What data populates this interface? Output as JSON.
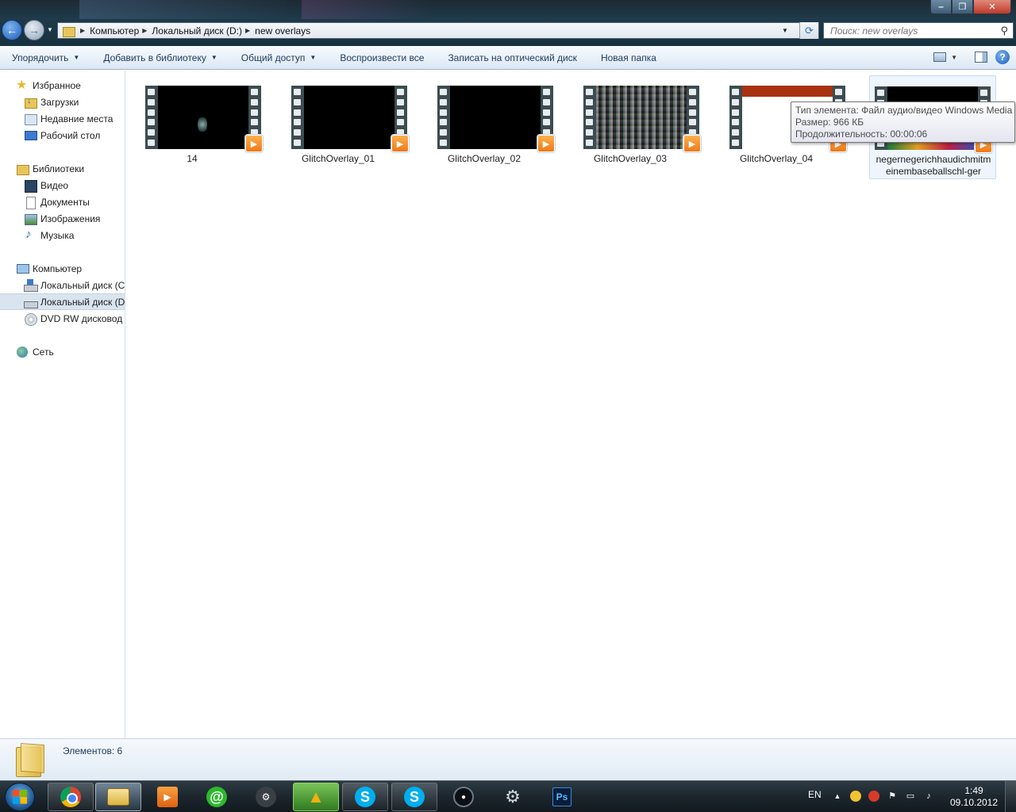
{
  "window": {
    "controls": {
      "minimize": "‒",
      "maximize": "❐",
      "close": "✕"
    }
  },
  "address_bar": {
    "breadcrumbs": [
      "Компьютер",
      "Локальный диск (D:)",
      "new overlays"
    ],
    "refresh_icon": "refresh-icon"
  },
  "search": {
    "placeholder": "Поиск: new overlays",
    "icon": "search-icon"
  },
  "command_bar": {
    "organize": "Упорядочить",
    "add_to_library": "Добавить в библиотеку",
    "share": "Общий доступ",
    "play_all": "Воспроизвести все",
    "burn": "Записать на оптический диск",
    "new_folder": "Новая папка"
  },
  "nav": {
    "favorites": {
      "label": "Избранное",
      "items": [
        "Загрузки",
        "Недавние места",
        "Рабочий стол"
      ]
    },
    "libraries": {
      "label": "Библиотеки",
      "items": [
        "Видео",
        "Документы",
        "Изображения",
        "Музыка"
      ]
    },
    "computer": {
      "label": "Компьютер",
      "items": [
        "Локальный диск (C",
        "Локальный диск (D",
        "DVD RW дисковод ("
      ]
    },
    "network": {
      "label": "Сеть"
    }
  },
  "files": [
    {
      "name": "14",
      "thumb": "dark-smoke"
    },
    {
      "name": "GlitchOverlay_01",
      "thumb": "black"
    },
    {
      "name": "GlitchOverlay_02",
      "thumb": "black"
    },
    {
      "name": "GlitchOverlay_03",
      "thumb": "glitch"
    },
    {
      "name": "GlitchOverlay_04",
      "thumb": "red-white"
    },
    {
      "name": "negernegerichhaudichmitmeinembaseballschl-ger",
      "thumb": "dark-colorbar"
    }
  ],
  "tooltip": {
    "type": "Тип элемента: Файл аудио/видео Windows Media",
    "size": "Размер: 966 КБ",
    "duration": "Продолжительность: 00:00:06"
  },
  "details": {
    "count": "Элементов: 6"
  },
  "taskbar": {
    "language": "EN",
    "time": "1:49",
    "date": "09.10.2012",
    "apps": [
      "chrome-icon",
      "explorer-icon",
      "media-player-icon",
      "mail-agent-icon",
      "steam-icon",
      "aimp-icon",
      "skype-icon",
      "skype-icon",
      "webcam-icon",
      "settings-icon",
      "photoshop-icon"
    ],
    "ps_label": "Ps"
  }
}
